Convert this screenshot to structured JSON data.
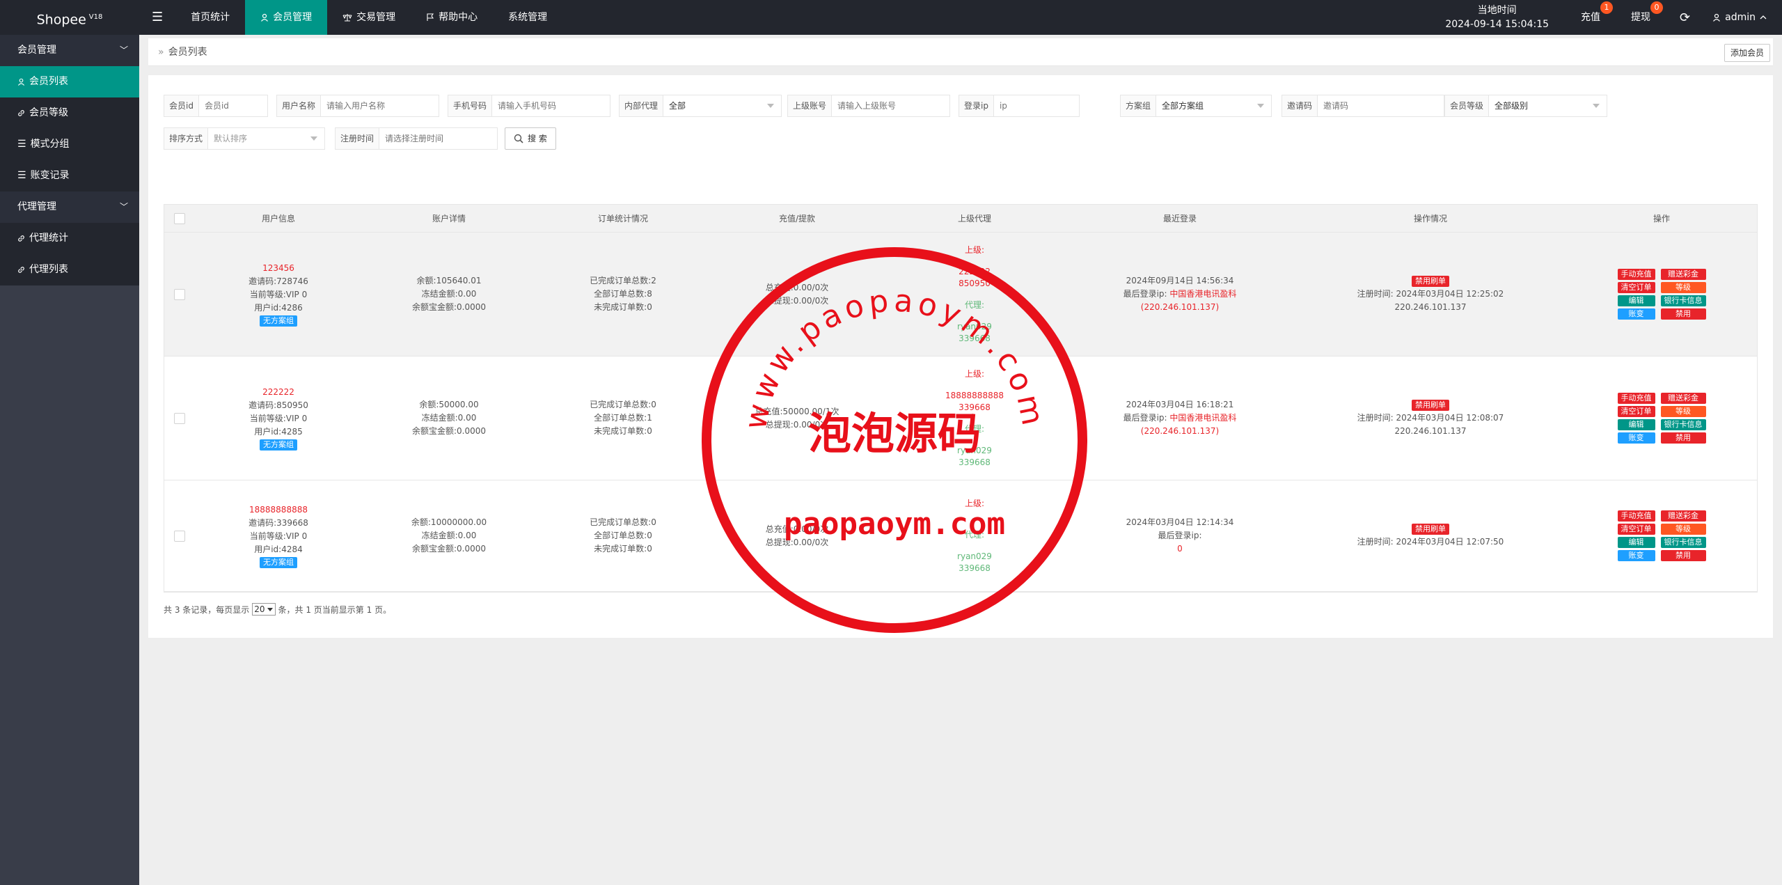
{
  "app": {
    "brand": "Shopee",
    "version": "V18"
  },
  "topnav": [
    {
      "label": "首页统计",
      "icon": ""
    },
    {
      "label": "会员管理",
      "icon": "user-icon",
      "active": true
    },
    {
      "label": "交易管理",
      "icon": "scale-icon"
    },
    {
      "label": "帮助中心",
      "icon": "flag-icon"
    },
    {
      "label": "系统管理",
      "icon": ""
    }
  ],
  "clock": {
    "label": "当地时间",
    "value": "2024-09-14 15:04:15"
  },
  "topright": {
    "recharge": {
      "label": "充值",
      "badge": "1"
    },
    "withdraw": {
      "label": "提现",
      "badge": "0"
    },
    "user": "admin"
  },
  "sidebar": [
    {
      "type": "group",
      "label": "会员管理"
    },
    {
      "type": "item",
      "label": "会员列表",
      "icon": "user-icon",
      "active": true
    },
    {
      "type": "item",
      "label": "会员等级",
      "icon": "link-icon"
    },
    {
      "type": "item",
      "label": "模式分组",
      "icon": "list-icon"
    },
    {
      "type": "item",
      "label": "账变记录",
      "icon": "list-icon"
    },
    {
      "type": "group",
      "label": "代理管理"
    },
    {
      "type": "item",
      "label": "代理统计",
      "icon": "link-icon"
    },
    {
      "type": "item",
      "label": "代理列表",
      "icon": "link-icon"
    }
  ],
  "breadcrumb": {
    "arrow": "»",
    "current": "会员列表",
    "add_button": "添加会员"
  },
  "filters": {
    "member_id": {
      "label": "会员id",
      "placeholder": "会员id"
    },
    "username": {
      "label": "用户名称",
      "placeholder": "请输入用户名称"
    },
    "phone": {
      "label": "手机号码",
      "placeholder": "请输入手机号码"
    },
    "internal_agent": {
      "label": "内部代理",
      "value": "全部"
    },
    "superior": {
      "label": "上级账号",
      "placeholder": "请输入上级账号"
    },
    "login_ip": {
      "label": "登录ip",
      "placeholder": "ip"
    },
    "plan_group": {
      "label": "方案组",
      "value": "全部方案组"
    },
    "invite_code": {
      "label": "邀请码",
      "placeholder": "邀请码"
    },
    "member_level": {
      "label": "会员等级",
      "value": "全部级别"
    },
    "sort": {
      "label": "排序方式",
      "value": "默认排序"
    },
    "register_time": {
      "label": "注册时间",
      "placeholder": "请选择注册时间"
    },
    "search_button": "搜 索"
  },
  "table": {
    "headers": [
      "",
      "用户信息",
      "账户详情",
      "订单统计情况",
      "充值/提款",
      "上级代理",
      "最近登录",
      "操作情况",
      "操作"
    ],
    "rows": [
      {
        "username": "123456",
        "invite": "邀请码:728746",
        "level": "当前等级:VIP 0",
        "uid": "用户id:4286",
        "group_tag": "无方案组",
        "balance": "余额:105640.01",
        "frozen": "冻结金额:0.00",
        "yuebao": "余额宝金额:0.0000",
        "orders_done": "已完成订单总数:2",
        "orders_all": "全部订单总数:8",
        "orders_pending": "未完成订单数:0",
        "recharge": "总充值:0.00/0次",
        "withdraw": "总提现:0.00/0次",
        "sup_label": "上级:",
        "sup_name": "222222",
        "sup_code": "850950",
        "agent_label": "代理:",
        "agent_name": "ryan029",
        "agent_code": "339668",
        "login_time": "2024年09月14日 14:56:34",
        "login_ip_label": "最后登录ip:",
        "login_region": "中国香港电讯盈科",
        "login_ip": "(220.246.101.137)",
        "status_tag": "禁用刷单",
        "reg_time": "注册时间:  2024年03月04日 12:25:02",
        "reg_ip": "220.246.101.137"
      },
      {
        "username": "222222",
        "invite": "邀请码:850950",
        "level": "当前等级:VIP 0",
        "uid": "用户id:4285",
        "group_tag": "无方案组",
        "balance": "余额:50000.00",
        "frozen": "冻结金额:0.00",
        "yuebao": "余额宝金额:0.0000",
        "orders_done": "已完成订单总数:0",
        "orders_all": "全部订单总数:1",
        "orders_pending": "未完成订单数:0",
        "recharge": "总充值:50000.00/1次",
        "withdraw": "总提现:0.00/0次",
        "sup_label": "上级:",
        "sup_name": "18888888888",
        "sup_code": "339668",
        "agent_label": "代理:",
        "agent_name": "ryan029",
        "agent_code": "339668",
        "login_time": "2024年03月04日 16:18:21",
        "login_ip_label": "最后登录ip:",
        "login_region": "中国香港电讯盈科",
        "login_ip": "(220.246.101.137)",
        "status_tag": "禁用刷单",
        "reg_time": "注册时间:  2024年03月04日 12:08:07",
        "reg_ip": "220.246.101.137"
      },
      {
        "username": "18888888888",
        "invite": "邀请码:339668",
        "level": "当前等级:VIP 0",
        "uid": "用户id:4284",
        "group_tag": "无方案组",
        "balance": "余额:10000000.00",
        "frozen": "冻结金额:0.00",
        "yuebao": "余额宝金额:0.0000",
        "orders_done": "已完成订单总数:0",
        "orders_all": "全部订单总数:0",
        "orders_pending": "未完成订单数:0",
        "recharge": "总充值:0.00/0次",
        "withdraw": "总提现:0.00/0次",
        "sup_label": "上级:",
        "sup_name": "",
        "sup_code": "",
        "agent_label": "代理:",
        "agent_name": "ryan029",
        "agent_code": "339668",
        "login_time": "2024年03月04日 12:14:34",
        "login_ip_label": "最后登录ip:",
        "login_region": "",
        "login_ip": "0",
        "status_tag": "禁用刷单",
        "reg_time": "注册时间:  2024年03月04日 12:07:50",
        "reg_ip": ""
      }
    ],
    "actions": [
      "手动充值",
      "赠送彩金",
      "清空订单",
      "等级",
      "编辑",
      "银行卡信息",
      "账变",
      "禁用"
    ]
  },
  "pager": {
    "prefix": "共 3 条记录，每页显示",
    "page_size": "20",
    "suffix": "条，共 1 页当前显示第 1 页。"
  },
  "watermark": {
    "top_text": "www.paopaoym.com",
    "center_text": "泡泡源码",
    "bottom_text": "paopaoym.com"
  },
  "colors": {
    "accent": "#009688",
    "topbar": "#23262e",
    "sidebar": "#393d49",
    "danger": "#e8242a",
    "warning": "#ff5722",
    "info": "#1e9fff"
  }
}
